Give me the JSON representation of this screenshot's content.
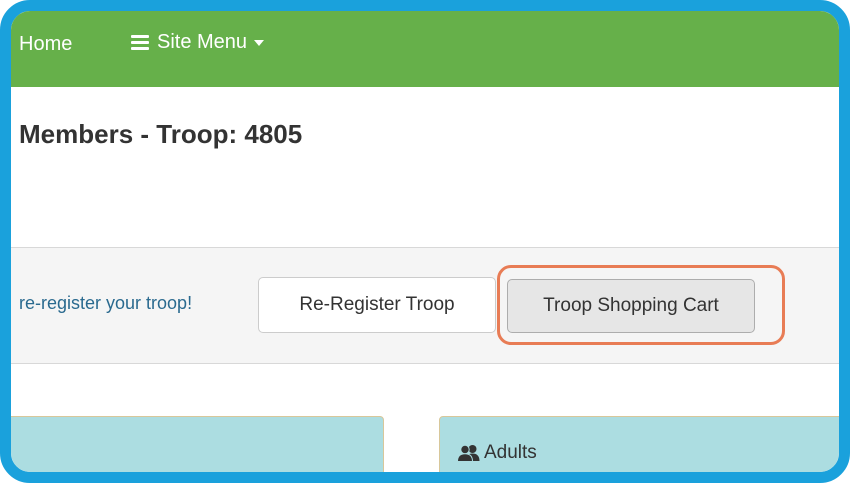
{
  "navbar": {
    "home_label": "Home",
    "site_menu_label": "Site Menu"
  },
  "page": {
    "title": "Members - Troop: 4805"
  },
  "banner": {
    "link_text": "re-register your troop!",
    "reregister_button": "Re-Register Troop",
    "cart_button": "Troop Shopping Cart"
  },
  "panels": {
    "adults_heading": "Adults"
  },
  "colors": {
    "frame_border": "#1aa1dc",
    "navbar": "#66b04a",
    "highlight": "#e87c55",
    "panel": "#acdde1",
    "link": "#2a6a8f"
  }
}
